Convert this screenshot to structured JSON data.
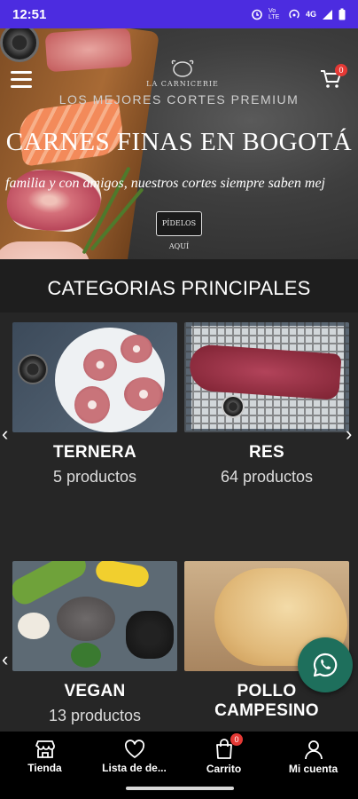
{
  "status_bar": {
    "time": "12:51",
    "network": "4G",
    "volte": "Vo LTE"
  },
  "hero": {
    "logo_text": "LA CARNICERIE",
    "subtitle": "LOS MEJORES CORTES PREMIUM",
    "title": "CARNES FINAS EN BOGOTÁ",
    "tagline": "familia y con amigos, nuestros cortes siempre saben mej",
    "cta_label": "PÍDELOS AQUÍ",
    "cart_count": "0"
  },
  "section": {
    "title": "CATEGORIAS PRINCIPALES"
  },
  "categories": [
    {
      "name": "TERNERA",
      "count": "5 productos"
    },
    {
      "name": "RES",
      "count": "64 productos"
    },
    {
      "name": "VEGAN",
      "count": "13 productos"
    },
    {
      "name": "POLLO CAMPESINO",
      "count": ""
    }
  ],
  "bottom_nav": {
    "items": [
      {
        "label": "Tienda",
        "icon": "store-icon"
      },
      {
        "label": "Lista de de...",
        "icon": "heart-icon"
      },
      {
        "label": "Carrito",
        "icon": "bag-icon",
        "badge": "0"
      },
      {
        "label": "Mi cuenta",
        "icon": "user-icon"
      }
    ]
  },
  "colors": {
    "status_bar": "#4c2ce0",
    "background": "#1c1c1c",
    "whatsapp": "#1e6f5c",
    "badge": "#e53935"
  }
}
